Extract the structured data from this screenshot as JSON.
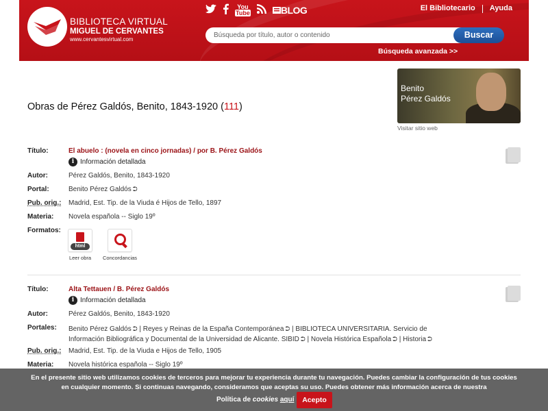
{
  "header": {
    "logo_line1": "BIBLIOTECA VIRTUAL",
    "logo_line2": "MIGUEL DE CERVANTES",
    "logo_line3": "www.cervantesvirtual.com",
    "social": {
      "twitter": "twitter-icon",
      "facebook": "facebook-icon",
      "youtube_top": "You",
      "youtube_bottom": "Tube",
      "rss": "rss-icon",
      "blog_label": "BLOG"
    },
    "top_links": [
      "El Bibliotecario",
      "Ayuda"
    ],
    "search_placeholder": "Búsqueda por título, autor o contenido",
    "search_button": "Buscar",
    "advanced_search": "Búsqueda avanzada  >>"
  },
  "main": {
    "title_prefix": "Obras de Pérez Galdós, Benito, 1843-1920 (",
    "title_count": "111",
    "title_suffix": ")",
    "portrait_line1": "Benito",
    "portrait_line2": "Pérez  Galdós",
    "visit_site": "Visitar sitio web"
  },
  "records": [
    {
      "labels": {
        "titulo": "Título:",
        "autor": "Autor:",
        "portal": "Portal:",
        "pub": "Pub. orig.:",
        "materia": "Materia:",
        "formatos": "Formatos:"
      },
      "title": "El abuelo : (novela en cinco jornadas) / por B. Pérez Galdós",
      "info": "Información detallada",
      "autor": "Pérez Galdós, Benito, 1843-1920",
      "portal": "Benito Pérez Galdós",
      "pub": "Madrid, Est. Tip. de la Viuda é Hijos de Tello, 1897",
      "materia": "Novela española -- Siglo 19º",
      "formatos": [
        {
          "tag": "html",
          "label": "Leer obra"
        },
        {
          "label": "Concordancias"
        }
      ]
    },
    {
      "labels": {
        "titulo": "Título:",
        "autor": "Autor:",
        "portales": "Portales:",
        "pub": "Pub. orig.:",
        "materia": "Materia:"
      },
      "title": "Alta Tettauen / B. Pérez Galdós",
      "info": "Información detallada",
      "autor": "Pérez Galdós, Benito, 1843-1920",
      "portales_line1_a": "Benito Pérez Galdós",
      "portales_line1_b": "| Reyes y Reinas de la España Contemporánea",
      "portales_line1_c": "| BIBLIOTECA UNIVERSITARIA. Servicio de",
      "portales_line2_a": "Información Bibliográfica y Documental de la Universidad de Alicante. SIBID",
      "portales_line2_b": "| Novela Histórica Española",
      "portales_line2_c": "| Historia",
      "pub": "Madrid, Est. Tip. de la Viuda e Hijos de Tello, 1905",
      "materia": "Novela histórica española -- Siglo 19º"
    }
  ],
  "cookie": {
    "text": "En el presente sitio web utilizamos cookies de terceros para mejorar tu experiencia durante tu navegación. Puedes cambiar la configuración de tus cookies en cualquier momento. Si continuas navegando, consideramos que aceptas su uso. Puedes obtener más información acerca de nuestra",
    "policy_prefix": "Política de ",
    "policy_italic": "cookies",
    "policy_link": "aquí",
    "accept": "Acepto"
  },
  "colors": {
    "brand_red": "#c8141b",
    "search_blue": "#2d6fbf",
    "link_red": "#9b1216"
  }
}
